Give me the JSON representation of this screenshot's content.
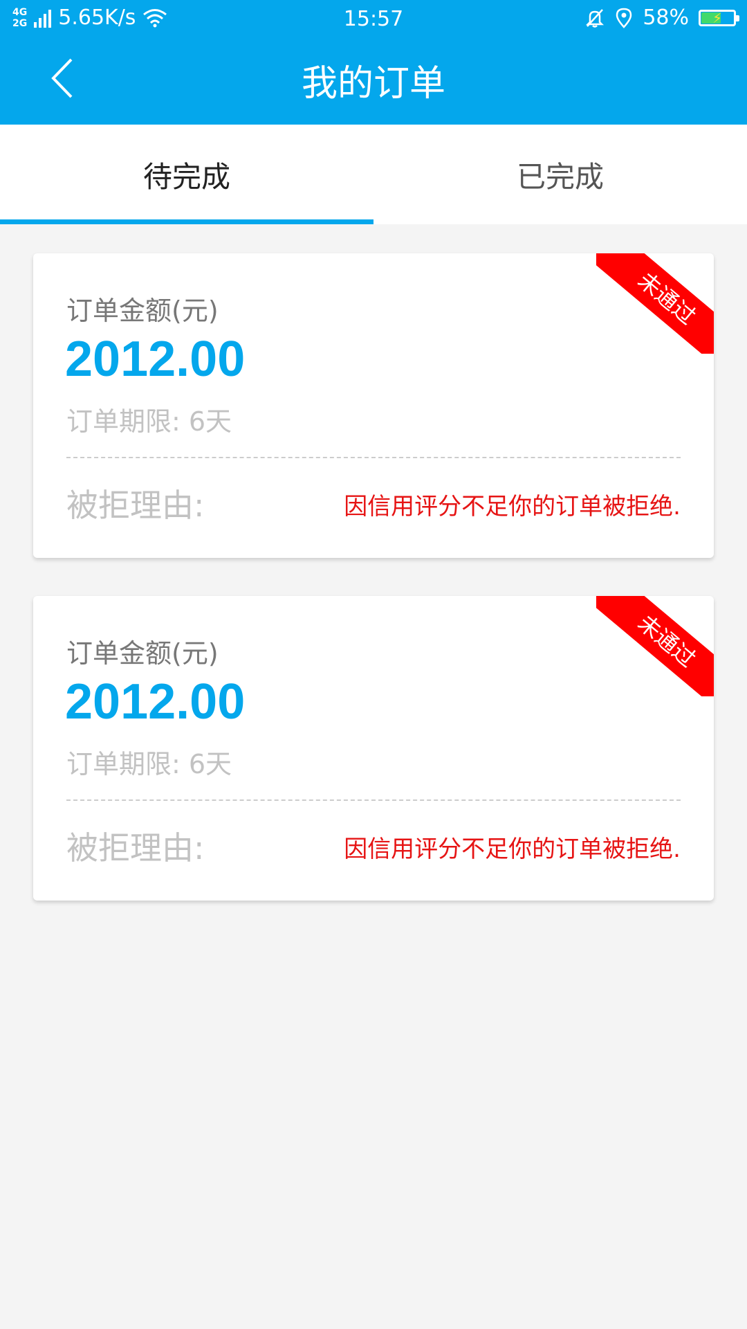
{
  "status_bar": {
    "network_type_top": "4G",
    "network_type_bottom": "2G",
    "speed": "5.65K/s",
    "time": "15:57",
    "battery_percent": "58%",
    "battery_level": 0.58,
    "icons": [
      "signal-icon",
      "wifi-icon",
      "mute-bell-icon",
      "location-icon",
      "battery-icon"
    ]
  },
  "header": {
    "back_icon": "chevron-left-icon",
    "title": "我的订单"
  },
  "tabs": [
    {
      "label": "待完成",
      "active": true
    },
    {
      "label": "已完成",
      "active": false
    }
  ],
  "orders": [
    {
      "amount_label": "订单金额(元)",
      "amount": "2012.00",
      "term": "订单期限: 6天",
      "status_ribbon": "未通过",
      "reject_label": "被拒理由:",
      "reject_reason": "因信用评分不足你的订单被拒绝."
    },
    {
      "amount_label": "订单金额(元)",
      "amount": "2012.00",
      "term": "订单期限: 6天",
      "status_ribbon": "未通过",
      "reject_label": "被拒理由:",
      "reject_reason": "因信用评分不足你的订单被拒绝."
    }
  ],
  "colors": {
    "primary": "#04a7ec",
    "ribbon": "#ff0000",
    "reject_text": "#e61414",
    "background": "#f4f4f4"
  }
}
